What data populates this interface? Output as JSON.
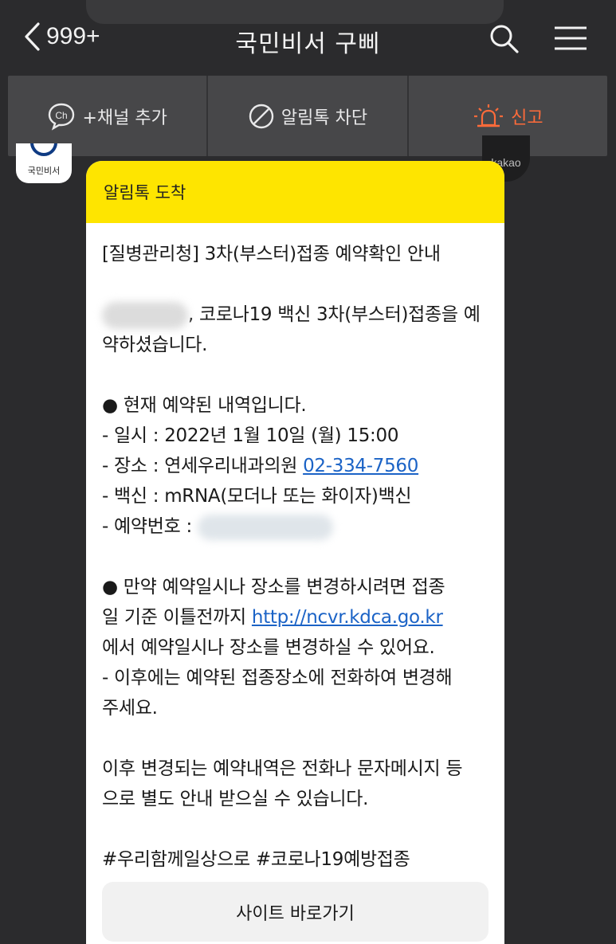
{
  "header": {
    "back_count": "999+",
    "title": "국민비서 구삐"
  },
  "actions": [
    {
      "label": "+채널 추가",
      "icon": "channel-icon"
    },
    {
      "label": "알림톡 차단",
      "icon": "block-icon"
    },
    {
      "label": "신고",
      "icon": "siren-icon"
    }
  ],
  "avatar": {
    "label": "국민비서"
  },
  "kakao_badge": "kakao",
  "message": {
    "header": "알림톡 도착",
    "title": "[질병관리청] 3차(부스터)접종 예약확인 안내",
    "intro_suffix": ", 코로나19 백신 3차(부스터)접종을 예",
    "intro_line2": "약하셨습니다.",
    "reservation_heading": "● 현재 예약된 내역입니다.",
    "datetime": " - 일시 : 2022년 1월 10일 (월) 15:00",
    "place_prefix": " - 장소 : 연세우리내과의원 ",
    "place_phone": "02-334-7560",
    "vaccine": " - 백신 : mRNA(모더나 또는 화이자)백신",
    "reservation_no_label": " - 예약번호 : ",
    "change_line1": "● 만약 예약일시나 장소를 변경하시려면 접종",
    "change_line2_prefix": "일 기준 이틀전까지 ",
    "change_link": "http://ncvr.kdca.go.kr",
    "change_line3": "에서 예약일시나 장소를 변경하실 수 있어요.",
    "after_line1": " - 이후에는 예약된 접종장소에 전화하여 변경해",
    "after_line2": " 주세요.",
    "notice_line1": "이후 변경되는 예약내역은 전화나 문자메시지 등",
    "notice_line2": "으로 별도 안내 받으실 수 있습니다.",
    "hashtags": "#우리함께일상으로 #코로나19예방접종",
    "site_button": "사이트 바로가기"
  },
  "colors": {
    "background": "#2b2b2d",
    "action_bar": "#474749",
    "report": "#ff6b3a",
    "bubble_header": "#fee500",
    "link": "#1b63c6"
  }
}
